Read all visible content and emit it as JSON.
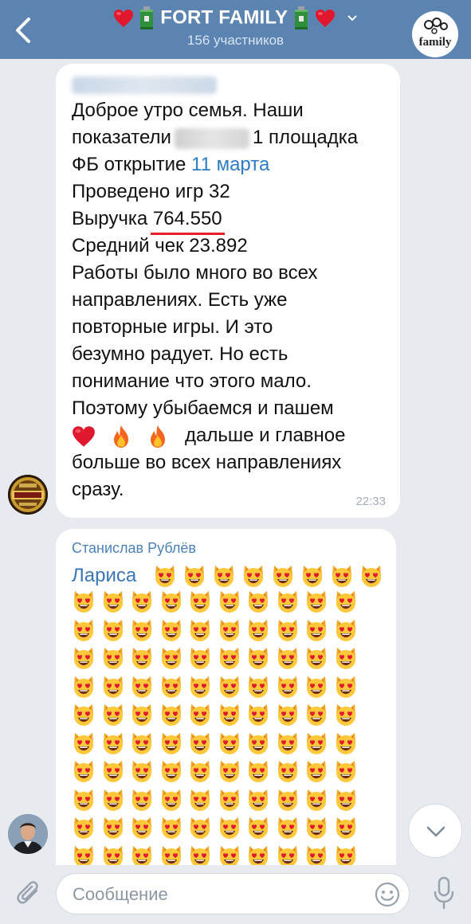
{
  "header": {
    "title": "FORT FAMILY",
    "subtitle": "156 участников",
    "avatar_text": "family"
  },
  "messages": [
    {
      "lines": {
        "l1": "Доброе утро семья. Наши",
        "l2_a": "показатели",
        "l2_b": "1 площадка",
        "l3_a": "ФБ открытие",
        "l3_date": "11 марта",
        "l4": "Проведено игр 32",
        "l5_a": "Выручка",
        "l5_value": "764.550",
        "l6": "Средний чек 23.892",
        "l7": "Работы было много во всех",
        "l8": "направлениях. Есть уже",
        "l9": "повторные игры. И это",
        "l10": "безумно радует.  Но есть",
        "l11": "понимание что этого мало.",
        "l12": "Поэтому убыбаемся и пашем",
        "l13_text": "дальше и главное",
        "l14": "больше во всех направлениях",
        "l15": "сразу."
      },
      "time": "22:33"
    },
    {
      "sender": "Станислав Рублёв",
      "addressee": "Лариса"
    }
  ],
  "composer": {
    "placeholder": "Сообщение"
  },
  "colors": {
    "header_bg": "#5b84b1",
    "chat_bg": "#e7ebf0",
    "link": "#2f7bc6",
    "sender": "#4c82b8",
    "underline": "#e5202a"
  },
  "icons": [
    "back-arrow-icon",
    "heart-icon",
    "fuel-can-icon",
    "chevron-down-icon",
    "fire-icon",
    "heart-eyes-cat-icon",
    "paperclip-icon",
    "sticker-icon",
    "microphone-icon"
  ]
}
